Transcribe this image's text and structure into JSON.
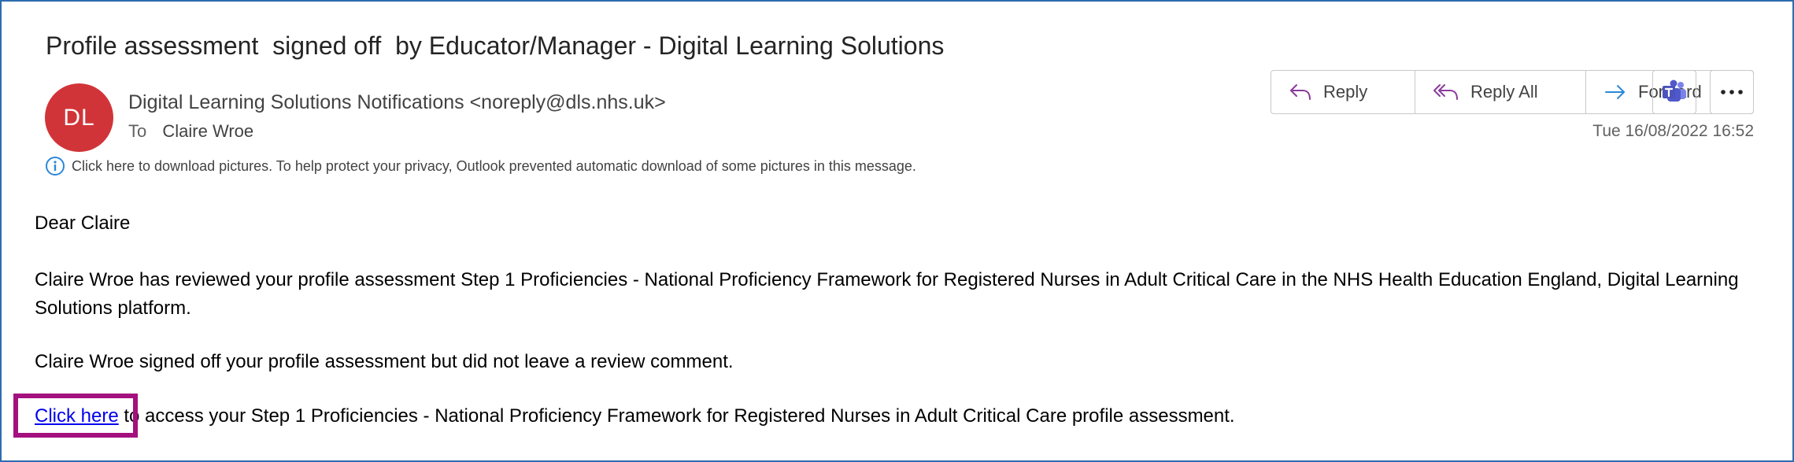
{
  "email": {
    "subject": "Profile assessment  signed off  by Educator/Manager - Digital Learning Solutions",
    "avatar_initials": "DL",
    "avatar_color": "#d13438",
    "sender": "Digital Learning Solutions Notifications <noreply@dls.nhs.uk>",
    "to_label": "To",
    "to_name": "Claire Wroe",
    "timestamp": "Tue 16/08/2022 16:52",
    "info_message": "Click here to download pictures. To help protect your privacy, Outlook prevented automatic download of some pictures in this message."
  },
  "actions": {
    "reply": "Reply",
    "reply_all": "Reply All",
    "forward": "Forward",
    "teams_icon": "teams-icon",
    "more_icon": "more-options-icon"
  },
  "body": {
    "greeting": "Dear Claire",
    "paragraph1": "Claire Wroe has reviewed your profile assessment Step 1 Proficiencies - National Proficiency Framework for Registered Nurses in Adult Critical Care in the NHS Health Education England, Digital Learning Solutions platform.",
    "paragraph2": "Claire Wroe signed off your profile assessment but did not leave a review comment.",
    "link_text": "Click here",
    "paragraph3_rest": " to access your Step 1 Proficiencies - National Proficiency Framework for Registered Nurses in Adult Critical Care profile assessment."
  },
  "colors": {
    "frame_border": "#2e6bb0",
    "highlight": "#a4107e",
    "reply_icon": "#8a3b9a",
    "forward_icon": "#2b88d8",
    "link": "#0000ee"
  }
}
